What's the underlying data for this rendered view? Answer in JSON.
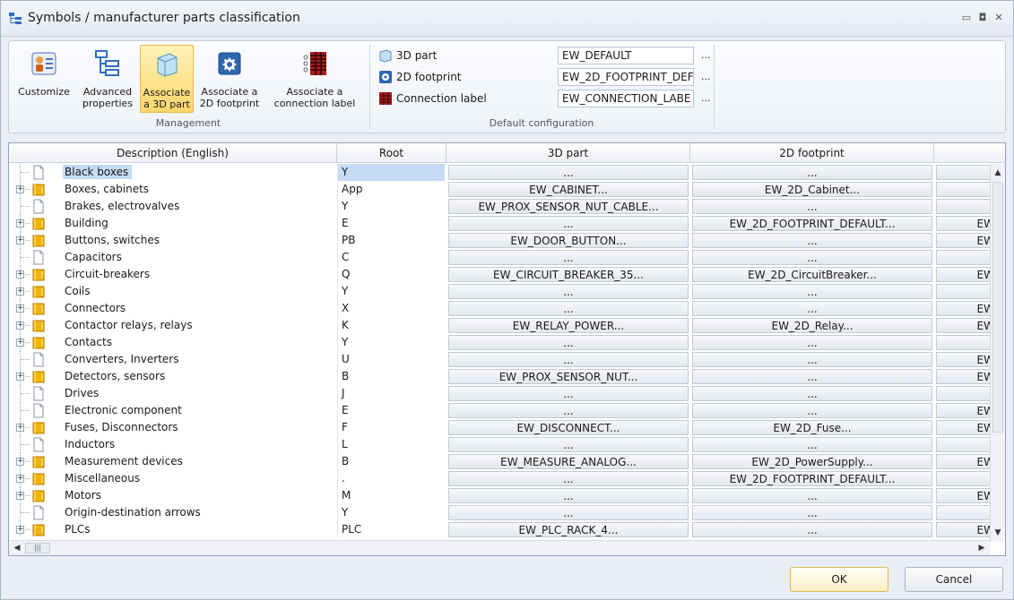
{
  "window": {
    "title": "Symbols / manufacturer parts classification",
    "controls": [
      "minimize",
      "restore",
      "close"
    ]
  },
  "ribbon": {
    "management": {
      "label": "Management",
      "buttons": [
        {
          "name": "customize",
          "label": "Customize"
        },
        {
          "name": "advanced-properties",
          "label": "Advanced properties"
        },
        {
          "name": "associate-3d-part",
          "label": "Associate a 3D part",
          "active": true
        },
        {
          "name": "associate-2d-footprint",
          "label": "Associate a 2D footprint"
        },
        {
          "name": "associate-connection-label",
          "label": "Associate a connection label"
        }
      ]
    },
    "default_configuration": {
      "label": "Default configuration",
      "rows": [
        {
          "label": "3D part",
          "value": "EW_DEFAULT",
          "more": "..."
        },
        {
          "label": "2D footprint",
          "value": "EW_2D_FOOTPRINT_DEF",
          "more": "..."
        },
        {
          "label": "Connection label",
          "value": "EW_CONNECTION_LABE",
          "more": "..."
        }
      ]
    }
  },
  "grid": {
    "columns": [
      "Description (English)",
      "Root",
      "3D part",
      "2D footprint",
      ""
    ],
    "rows": [
      {
        "desc": "Black boxes",
        "root": "Y",
        "part3d": "...",
        "fp2d": "...",
        "c3": "",
        "expandable": false,
        "selected": true
      },
      {
        "desc": "Boxes, cabinets",
        "root": "App",
        "part3d": "EW_CABINET...",
        "fp2d": "EW_2D_Cabinet...",
        "c3": "",
        "expandable": true
      },
      {
        "desc": "Brakes, electrovalves",
        "root": "Y",
        "part3d": "EW_PROX_SENSOR_NUT_CABLE...",
        "fp2d": "...",
        "c3": "",
        "expandable": false
      },
      {
        "desc": "Building",
        "root": "E",
        "part3d": "...",
        "fp2d": "EW_2D_FOOTPRINT_DEFAULT...",
        "c3": "EW",
        "expandable": true
      },
      {
        "desc": "Buttons, switches",
        "root": "PB",
        "part3d": "EW_DOOR_BUTTON...",
        "fp2d": "...",
        "c3": "EW",
        "expandable": true
      },
      {
        "desc": "Capacitors",
        "root": "C",
        "part3d": "...",
        "fp2d": "...",
        "c3": "",
        "expandable": false
      },
      {
        "desc": "Circuit-breakers",
        "root": "Q",
        "part3d": "EW_CIRCUIT_BREAKER_35...",
        "fp2d": "EW_2D_CircuitBreaker...",
        "c3": "EW",
        "expandable": true
      },
      {
        "desc": "Coils",
        "root": "Y",
        "part3d": "...",
        "fp2d": "...",
        "c3": "",
        "expandable": true
      },
      {
        "desc": "Connectors",
        "root": "X",
        "part3d": "...",
        "fp2d": "...",
        "c3": "EW",
        "expandable": true
      },
      {
        "desc": "Contactor relays, relays",
        "root": "K",
        "part3d": "EW_RELAY_POWER...",
        "fp2d": "EW_2D_Relay...",
        "c3": "EW",
        "expandable": true
      },
      {
        "desc": "Contacts",
        "root": "Y",
        "part3d": "...",
        "fp2d": "...",
        "c3": "",
        "expandable": true
      },
      {
        "desc": "Converters, Inverters",
        "root": "U",
        "part3d": "...",
        "fp2d": "...",
        "c3": "EW",
        "expandable": false
      },
      {
        "desc": "Detectors, sensors",
        "root": "B",
        "part3d": "EW_PROX_SENSOR_NUT...",
        "fp2d": "...",
        "c3": "EW",
        "expandable": true
      },
      {
        "desc": "Drives",
        "root": "J",
        "part3d": "...",
        "fp2d": "...",
        "c3": "",
        "expandable": false
      },
      {
        "desc": "Electronic component",
        "root": "E",
        "part3d": "...",
        "fp2d": "...",
        "c3": "EW",
        "expandable": false
      },
      {
        "desc": "Fuses, Disconnectors",
        "root": "F",
        "part3d": "EW_DISCONNECT...",
        "fp2d": "EW_2D_Fuse...",
        "c3": "EW",
        "expandable": true
      },
      {
        "desc": "Inductors",
        "root": "L",
        "part3d": "...",
        "fp2d": "...",
        "c3": "",
        "expandable": false
      },
      {
        "desc": "Measurement devices",
        "root": "B",
        "part3d": "EW_MEASURE_ANALOG...",
        "fp2d": "EW_2D_PowerSupply...",
        "c3": "EW",
        "expandable": true
      },
      {
        "desc": "Miscellaneous",
        "root": ".",
        "part3d": "...",
        "fp2d": "EW_2D_FOOTPRINT_DEFAULT...",
        "c3": "",
        "expandable": true
      },
      {
        "desc": "Motors",
        "root": "M",
        "part3d": "...",
        "fp2d": "...",
        "c3": "EW",
        "expandable": true
      },
      {
        "desc": "Origin-destination arrows",
        "root": "Y",
        "part3d": "...",
        "fp2d": "...",
        "c3": "",
        "expandable": false
      },
      {
        "desc": "PLCs",
        "root": "PLC",
        "part3d": "EW_PLC_RACK_4...",
        "fp2d": "...",
        "c3": "EW",
        "expandable": true
      }
    ]
  },
  "footer": {
    "ok_label": "OK",
    "cancel_label": "Cancel"
  },
  "colors": {
    "selection": "#c5dbf5",
    "active_button": "#ffd66b",
    "folder_icon": "#e8a400"
  }
}
